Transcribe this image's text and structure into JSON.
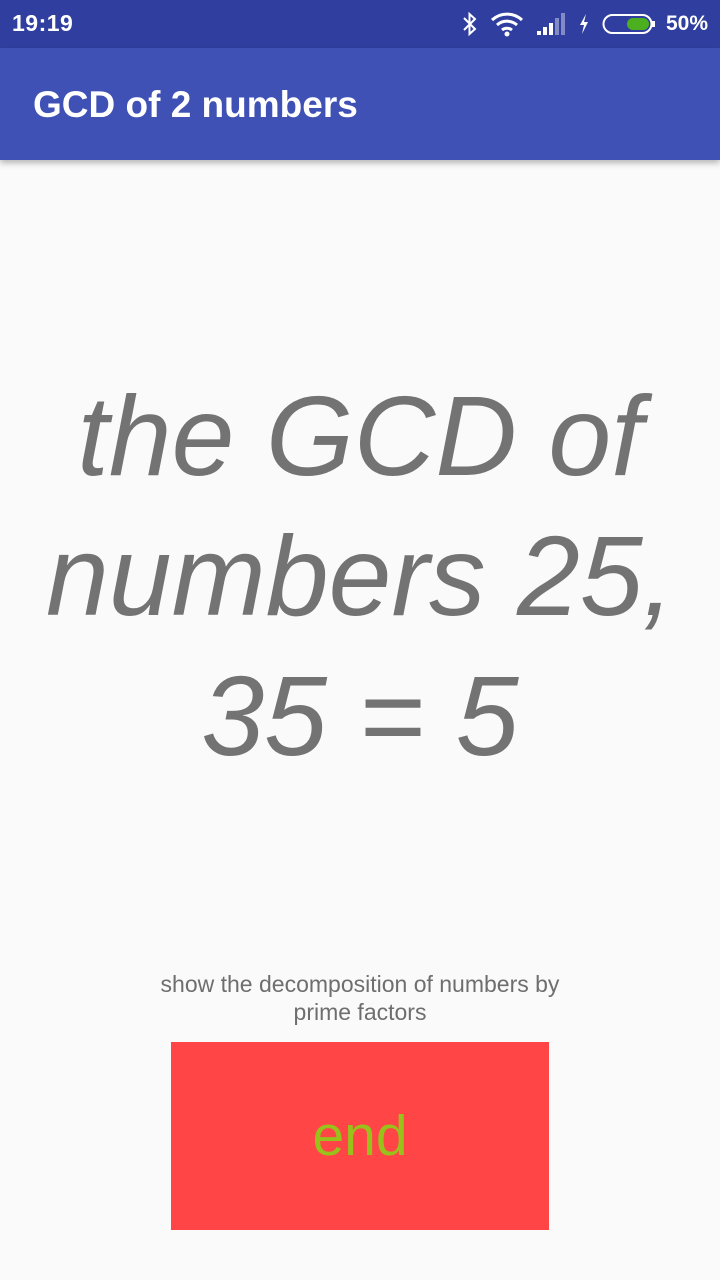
{
  "status_bar": {
    "time": "19:19",
    "battery_percent": "50%",
    "icons": [
      "bluetooth-icon",
      "wifi-icon",
      "signal-icon",
      "charging-icon",
      "battery-icon"
    ],
    "background_color": "#303f9f"
  },
  "app_bar": {
    "title": "GCD of 2 numbers",
    "background_color": "#3f51b5"
  },
  "main": {
    "result_text": "the GCD of numbers 25, 35 = 5",
    "decomposition_link": "show the decomposition of numbers by prime factors",
    "end_button_label": "end",
    "end_button_color": "#ff4545",
    "end_button_text_color": "#99c11c"
  }
}
